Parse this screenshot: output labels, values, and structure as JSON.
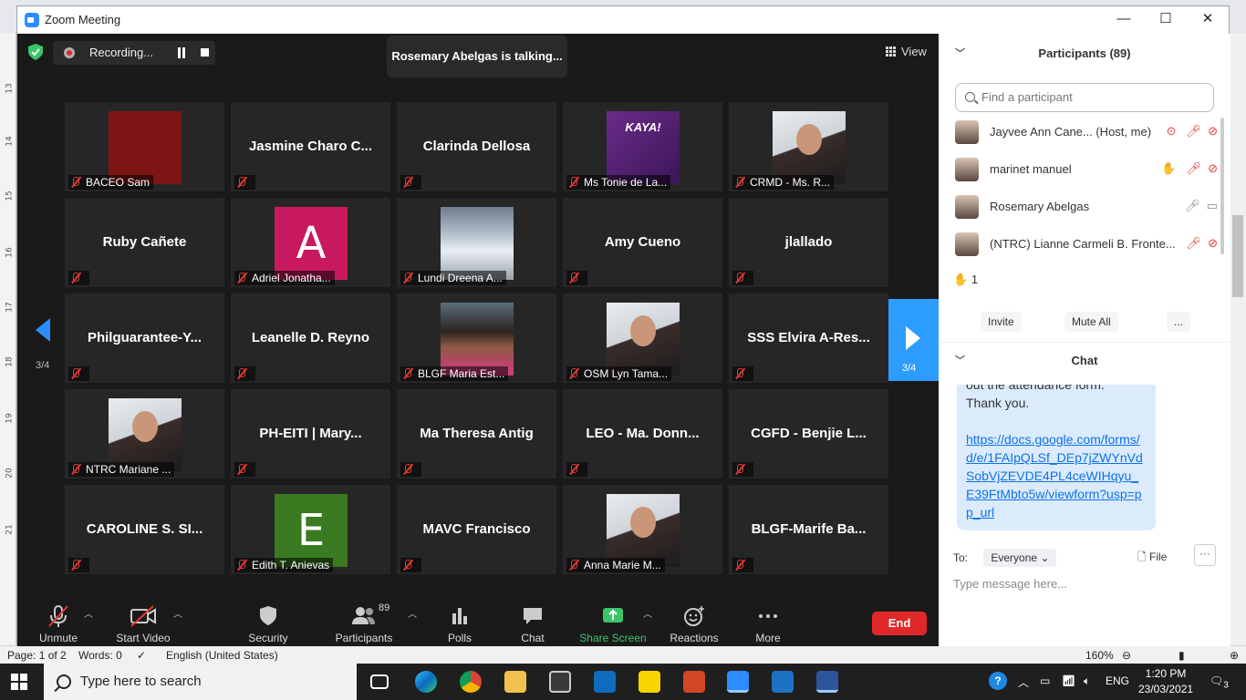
{
  "window": {
    "title": "Zoom Meeting",
    "minimize": "—",
    "maximize": "☐",
    "close": "✕"
  },
  "recording": {
    "label": "Recording..."
  },
  "talking": "Rosemary Abelgas is talking...",
  "view_label": "View",
  "pager": {
    "left": "3/4",
    "right": "3/4"
  },
  "tiles": [
    {
      "cap": "BACEO Sam"
    },
    {
      "center": "Jasmine Charo C..."
    },
    {
      "center": "Clarinda Dellosa"
    },
    {
      "cap": "Ms Tonie de La...",
      "pic_text": "KAYA!"
    },
    {
      "cap": "CRMD - Ms. R..."
    },
    {
      "center": "Ruby Cañete"
    },
    {
      "cap": "Adriel Jonatha...",
      "avatar": "A"
    },
    {
      "cap": "Lundi Dreena A..."
    },
    {
      "center": "Amy Cueno"
    },
    {
      "center": "jlallado"
    },
    {
      "center": "Philguarantee-Y..."
    },
    {
      "center": "Leanelle D. Reyno"
    },
    {
      "cap": "BLGF Maria Est..."
    },
    {
      "cap": "OSM Lyn Tama..."
    },
    {
      "center": "SSS  Elvira A-Res..."
    },
    {
      "cap": "NTRC Mariane ..."
    },
    {
      "center": "PH-EITI | Mary..."
    },
    {
      "center": "Ma Theresa Antig"
    },
    {
      "center": "LEO - Ma. Donn..."
    },
    {
      "center": "CGFD - Benjie L..."
    },
    {
      "center": "CAROLINE S. SI..."
    },
    {
      "cap": "Edith T. Anievas",
      "avatar": "E"
    },
    {
      "center": "MAVC Francisco"
    },
    {
      "cap": "Anna Marie M..."
    },
    {
      "center": "BLGF-Marife Ba..."
    }
  ],
  "toolbar": {
    "unmute": "Unmute",
    "start_video": "Start Video",
    "security": "Security",
    "participants": "Participants",
    "participants_count": "89",
    "polls": "Polls",
    "chat": "Chat",
    "share_screen": "Share Screen",
    "reactions": "Reactions",
    "more": "More",
    "end": "End"
  },
  "participants_panel": {
    "title": "Participants (89)",
    "search_placeholder": "Find a participant",
    "people": [
      {
        "name": "Jayvee Ann Cane... (Host, me)"
      },
      {
        "name": "marinet manuel"
      },
      {
        "name": "Rosemary Abelgas"
      },
      {
        "name": "(NTRC) Lianne Carmeli B. Fronte..."
      }
    ],
    "raised_hands": "1",
    "invite": "Invite",
    "mute_all": "Mute All",
    "more": "..."
  },
  "chat_panel": {
    "title": "Chat",
    "partial_line": "out the attendance form.",
    "thanks": "Thank you.",
    "link": "https://docs.google.com/forms/d/e/1FAIpQLSf_DEp7jZWYnVdSobVjZEVDE4PL4ceWIHqyu_E39FtMbto5w/viewform?usp=pp_url",
    "to_label": "To:",
    "recipient": "Everyone",
    "file": "File",
    "more": "···",
    "input_placeholder": "Type message here..."
  },
  "word_status": {
    "page": "Page: 1 of 2",
    "words": "Words: 0",
    "language": "English (United States)",
    "zoom": "160%"
  },
  "ruler_numbers": [
    "13",
    "14",
    "15",
    "16",
    "17",
    "18",
    "19",
    "20",
    "21"
  ],
  "taskbar": {
    "search_placeholder": "Type here to search",
    "language": "ENG",
    "time": "1:20 PM",
    "date": "23/03/2021",
    "notifications": "3"
  }
}
